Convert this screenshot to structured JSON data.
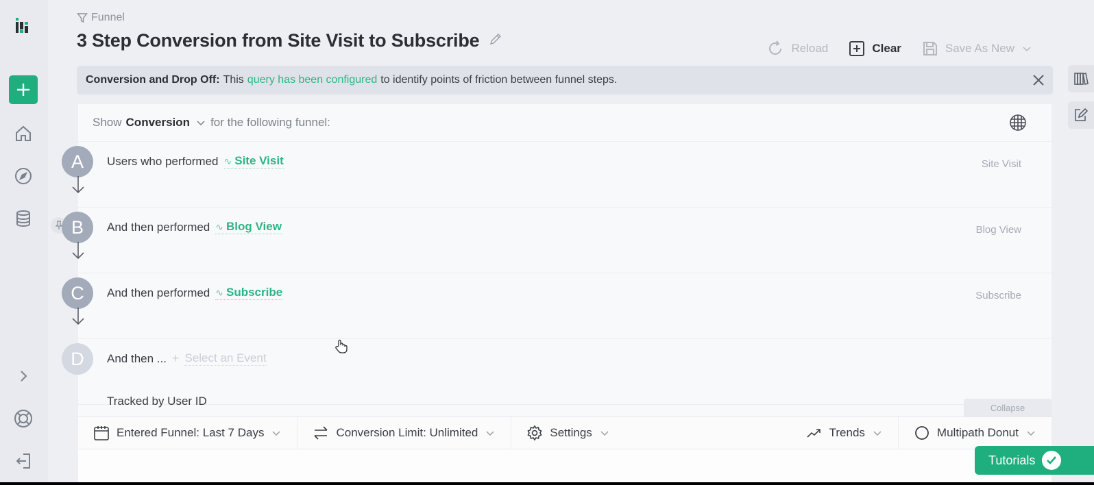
{
  "breadcrumb": {
    "icon": "funnel-icon",
    "label": "Funnel"
  },
  "header": {
    "title": "3 Step Conversion from Site Visit to Subscribe",
    "edit_icon": "pencil-icon"
  },
  "toolbar": {
    "reload_label": "Reload",
    "clear_label": "Clear",
    "save_label": "Save As New"
  },
  "sidebar": {
    "items": [
      {
        "name": "logo",
        "icon": "app-logo-icon"
      },
      {
        "name": "add",
        "icon": "plus-icon"
      },
      {
        "name": "home",
        "icon": "home-icon"
      },
      {
        "name": "explore",
        "icon": "compass-icon"
      },
      {
        "name": "data",
        "icon": "database-icon"
      },
      {
        "name": "expand",
        "icon": "chevron-right-icon"
      },
      {
        "name": "help",
        "icon": "lifebuoy-icon"
      },
      {
        "name": "logout",
        "icon": "logout-icon"
      }
    ]
  },
  "banner": {
    "bold": "Conversion and Drop Off:",
    "pre": "This",
    "link": "query has been configured",
    "post": "to identify points of friction between funnel steps."
  },
  "query": {
    "show_prefix": "Show",
    "metric": "Conversion",
    "show_suffix": "for the following funnel:",
    "steps": [
      {
        "letter": "A",
        "prefix": "Users who performed",
        "event": "Site Visit",
        "right_label": "Site Visit"
      },
      {
        "letter": "B",
        "prefix": "And then performed",
        "event": "Blog View",
        "right_label": "Blog View"
      },
      {
        "letter": "C",
        "prefix": "And then performed",
        "event": "Subscribe",
        "right_label": "Subscribe"
      },
      {
        "letter": "D",
        "prefix": "And then ...",
        "placeholder": "Select an Event"
      }
    ],
    "tracked_by": "Tracked by User ID",
    "collapse_label": "Collapse"
  },
  "options": {
    "date_range": "Entered Funnel: Last 7 Days",
    "conversion_limit": "Conversion Limit: Unlimited",
    "settings": "Settings",
    "trends": "Trends",
    "visualization": "Multipath Donut"
  },
  "tutorials": {
    "label": "Tutorials"
  },
  "colors": {
    "accent": "#1fae7e",
    "link": "#2fb383",
    "step_badge": "#a3aab9"
  }
}
